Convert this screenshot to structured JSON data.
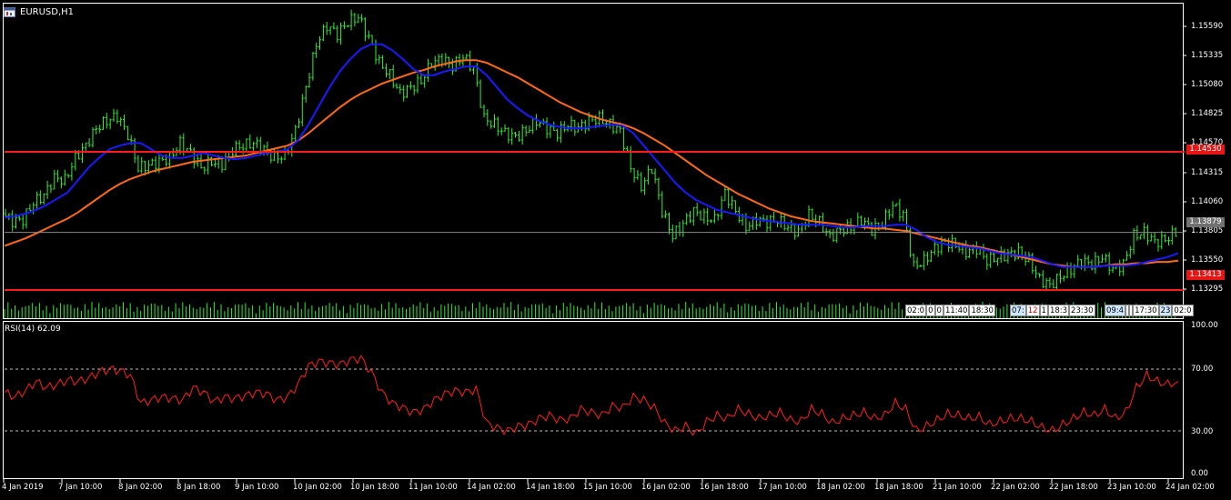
{
  "window": {
    "symbol_title": "EURUSD,H1"
  },
  "price_axis": {
    "labels": [
      "1.15590",
      "1.15335",
      "1.15080",
      "1.14825",
      "1.14570",
      "1.14315",
      "1.14060",
      "1.13805",
      "1.13550",
      "1.13295"
    ],
    "upper_line_price": "1.14530",
    "current_price": "1.13879",
    "lower_line_price": "1.13413"
  },
  "rsi": {
    "label": "RSI(14) 62.09",
    "axis_labels": [
      "100.00",
      "70.00",
      "30.00",
      "0.00"
    ]
  },
  "time_axis": {
    "labels": [
      "4 Jan 2019",
      "7 Jan 10:00",
      "8 Jan 02:00",
      "8 Jan 18:00",
      "9 Jan 10:00",
      "10 Jan 02:00",
      "10 Jan 18:00",
      "11 Jan 10:00",
      "14 Jan 02:00",
      "14 Jan 18:00",
      "15 Jan 10:00",
      "16 Jan 02:00",
      "16 Jan 18:00",
      "17 Jan 10:00",
      "18 Jan 02:00",
      "18 Jan 18:00",
      "21 Jan 10:00",
      "22 Jan 02:00",
      "22 Jan 18:00",
      "23 Jan 10:00",
      "24 Jan 02:00"
    ]
  },
  "news_events": {
    "group1": [
      "02:0",
      "0",
      "0",
      "11:40",
      "18:30"
    ],
    "group2": [
      "07:",
      "12",
      "1",
      "18:3",
      "23:30"
    ],
    "group3": [
      "09:4",
      "",
      "",
      "17:30",
      "23",
      "02:0"
    ]
  },
  "colors": {
    "candle": "#33ee33",
    "ma_fast": "#1a1aff",
    "ma_slow": "#ff6a1a",
    "level_line": "#ff1a1a",
    "rsi_line": "#ff2020",
    "badge_red": "#e81515",
    "badge_grey": "#707070"
  },
  "chart_data": {
    "type": "line",
    "title": "EURUSD,H1",
    "ylim": [
      1.132,
      1.1572
    ],
    "price_series": [
      1.1403,
      1.1397,
      1.1398,
      1.1412,
      1.1418,
      1.1432,
      1.143,
      1.1448,
      1.1458,
      1.1472,
      1.1478,
      1.1482,
      1.1467,
      1.144,
      1.1442,
      1.1445,
      1.1448,
      1.146,
      1.1452,
      1.144,
      1.1445,
      1.1443,
      1.1455,
      1.1458,
      1.146,
      1.1455,
      1.1448,
      1.145,
      1.147,
      1.1505,
      1.154,
      1.1555,
      1.1548,
      1.1558,
      1.1562,
      1.1545,
      1.1525,
      1.1515,
      1.15,
      1.1505,
      1.151,
      1.1525,
      1.1528,
      1.1522,
      1.153,
      1.152,
      1.148,
      1.1475,
      1.1468,
      1.1465,
      1.147,
      1.1478,
      1.1472,
      1.1468,
      1.1475,
      1.1472,
      1.1478,
      1.148,
      1.1475,
      1.147,
      1.144,
      1.1425,
      1.144,
      1.1405,
      1.1385,
      1.1395,
      1.1405,
      1.14,
      1.1398,
      1.142,
      1.1405,
      1.1392,
      1.1398,
      1.1396,
      1.1398,
      1.1392,
      1.1388,
      1.1402,
      1.1396,
      1.1384,
      1.139,
      1.1392,
      1.1398,
      1.139,
      1.1395,
      1.141,
      1.1402,
      1.136,
      1.1365,
      1.1375,
      1.138,
      1.1378,
      1.1372,
      1.1375,
      1.1365,
      1.1368,
      1.137,
      1.1372,
      1.1365,
      1.135,
      1.1345,
      1.1352,
      1.1358,
      1.1365,
      1.1362,
      1.1368,
      1.1358,
      1.1362,
      1.1385,
      1.1388,
      1.138,
      1.1382,
      1.1388
    ],
    "ma_fast_series": [
      1.14,
      1.1401,
      1.1403,
      1.1406,
      1.141,
      1.1415,
      1.142,
      1.143,
      1.144,
      1.1448,
      1.1455,
      1.1458,
      1.146,
      1.146,
      1.1455,
      1.145,
      1.1448,
      1.1448,
      1.145,
      1.1452,
      1.145,
      1.1448,
      1.1447,
      1.1448,
      1.145,
      1.1452,
      1.1453,
      1.1455,
      1.1462,
      1.1475,
      1.149,
      1.1505,
      1.1518,
      1.1528,
      1.1536,
      1.154,
      1.154,
      1.1535,
      1.1528,
      1.152,
      1.1515,
      1.1515,
      1.1518,
      1.152,
      1.1522,
      1.1522,
      1.1515,
      1.1505,
      1.1495,
      1.1488,
      1.1482,
      1.1478,
      1.1475,
      1.1473,
      1.1472,
      1.1472,
      1.1473,
      1.1474,
      1.1475,
      1.1474,
      1.1468,
      1.1458,
      1.1448,
      1.1438,
      1.1428,
      1.142,
      1.1414,
      1.141,
      1.1406,
      1.1404,
      1.1402,
      1.14,
      1.1398,
      1.1397,
      1.1396,
      1.1395,
      1.1394,
      1.1394,
      1.1394,
      1.1393,
      1.1392,
      1.1392,
      1.1393,
      1.1393,
      1.1393,
      1.1394,
      1.1394,
      1.139,
      1.1384,
      1.138,
      1.1378,
      1.1377,
      1.1376,
      1.1375,
      1.1373,
      1.1371,
      1.137,
      1.1369,
      1.1368,
      1.1365,
      1.1362,
      1.136,
      1.136,
      1.136,
      1.136,
      1.1361,
      1.1361,
      1.1361,
      1.1362,
      1.1364,
      1.1366,
      1.1368,
      1.1371
    ],
    "ma_slow_series": [
      1.1377,
      1.138,
      1.1383,
      1.1387,
      1.1391,
      1.1395,
      1.1399,
      1.1404,
      1.141,
      1.1416,
      1.1422,
      1.1427,
      1.1431,
      1.1434,
      1.1437,
      1.1439,
      1.1441,
      1.1443,
      1.1445,
      1.1446,
      1.1447,
      1.1448,
      1.1449,
      1.145,
      1.1452,
      1.1454,
      1.1456,
      1.1458,
      1.1462,
      1.1468,
      1.1475,
      1.1482,
      1.1489,
      1.1495,
      1.15,
      1.1504,
      1.1508,
      1.1511,
      1.1514,
      1.1517,
      1.1519,
      1.1522,
      1.1524,
      1.1526,
      1.1527,
      1.1527,
      1.1525,
      1.1521,
      1.1517,
      1.1513,
      1.1508,
      1.1503,
      1.1498,
      1.1493,
      1.1489,
      1.1485,
      1.1482,
      1.1479,
      1.1477,
      1.1475,
      1.1472,
      1.1468,
      1.1463,
      1.1458,
      1.1452,
      1.1446,
      1.144,
      1.1434,
      1.1429,
      1.1424,
      1.1419,
      1.1415,
      1.1411,
      1.1407,
      1.1404,
      1.1401,
      1.1399,
      1.1397,
      1.1396,
      1.1395,
      1.1394,
      1.1393,
      1.1392,
      1.1391,
      1.1391,
      1.139,
      1.1389,
      1.1387,
      1.1385,
      1.1383,
      1.1381,
      1.1379,
      1.1377,
      1.1376,
      1.1374,
      1.1372,
      1.137,
      1.1368,
      1.1366,
      1.1364,
      1.1362,
      1.1361,
      1.136,
      1.136,
      1.136,
      1.1361,
      1.1362,
      1.1362,
      1.1363,
      1.1363,
      1.1364,
      1.1364,
      1.1365
    ],
    "rsi_series": [
      55,
      52,
      56,
      62,
      58,
      60,
      63,
      62,
      64,
      68,
      70,
      69,
      66,
      48,
      50,
      52,
      51,
      50,
      58,
      55,
      49,
      52,
      51,
      53,
      55,
      54,
      50,
      52,
      60,
      72,
      75,
      74,
      73,
      76,
      77,
      68,
      55,
      48,
      45,
      42,
      44,
      50,
      54,
      56,
      55,
      57,
      35,
      32,
      30,
      33,
      34,
      38,
      40,
      37,
      38,
      44,
      42,
      40,
      46,
      45,
      52,
      50,
      45,
      35,
      30,
      33,
      28,
      36,
      40,
      38,
      44,
      41,
      38,
      40,
      42,
      37,
      36,
      44,
      41,
      35,
      38,
      40,
      42,
      38,
      40,
      48,
      44,
      30,
      33,
      37,
      41,
      40,
      38,
      39,
      34,
      36,
      38,
      38,
      36,
      32,
      30,
      34,
      38,
      42,
      40,
      44,
      38,
      42,
      58,
      66,
      62,
      60,
      62
    ],
    "upper_level": 1.1453,
    "lower_level": 1.13413,
    "current": 1.13879,
    "rsi_levels": [
      70,
      30
    ],
    "rsi_ylim": [
      0,
      100
    ]
  }
}
